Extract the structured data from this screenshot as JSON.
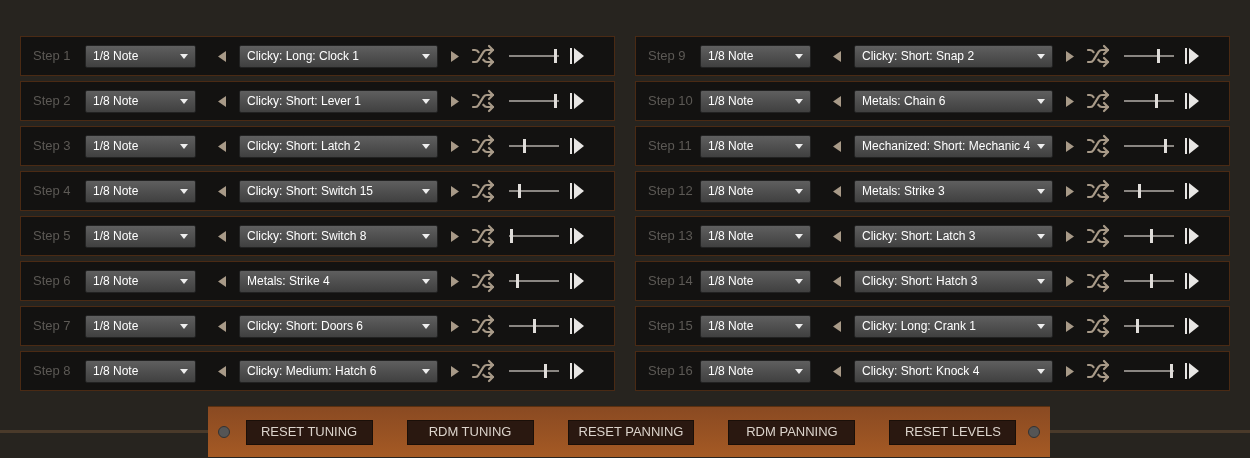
{
  "steps": [
    {
      "label": "Step 1",
      "rate": "1/8 Note",
      "sample": "Clicky: Long: Clock 1",
      "level": 0.95
    },
    {
      "label": "Step 2",
      "rate": "1/8 Note",
      "sample": "Clicky: Short: Lever 1",
      "level": 0.95
    },
    {
      "label": "Step 3",
      "rate": "1/8 Note",
      "sample": "Clicky: Short: Latch 2",
      "level": 0.3
    },
    {
      "label": "Step 4",
      "rate": "1/8 Note",
      "sample": "Clicky: Short: Switch 15",
      "level": 0.2
    },
    {
      "label": "Step 5",
      "rate": "1/8 Note",
      "sample": "Clicky: Short: Switch 8",
      "level": 0.03
    },
    {
      "label": "Step 6",
      "rate": "1/8 Note",
      "sample": "Metals: Strike 4",
      "level": 0.15
    },
    {
      "label": "Step 7",
      "rate": "1/8 Note",
      "sample": "Clicky: Short: Doors 6",
      "level": 0.5
    },
    {
      "label": "Step 8",
      "rate": "1/8 Note",
      "sample": "Clicky: Medium: Hatch 6",
      "level": 0.75
    },
    {
      "label": "Step 9",
      "rate": "1/8 Note",
      "sample": "Clicky: Short: Snap 2",
      "level": 0.7
    },
    {
      "label": "Step 10",
      "rate": "1/8 Note",
      "sample": "Metals: Chain 6",
      "level": 0.65
    },
    {
      "label": "Step 11",
      "rate": "1/8 Note",
      "sample": "Mechanized: Short: Mechanic 4",
      "level": 0.85
    },
    {
      "label": "Step 12",
      "rate": "1/8 Note",
      "sample": "Metals: Strike 3",
      "level": 0.3
    },
    {
      "label": "Step 13",
      "rate": "1/8 Note",
      "sample": "Clicky: Short: Latch 3",
      "level": 0.55
    },
    {
      "label": "Step 14",
      "rate": "1/8 Note",
      "sample": "Clicky: Short: Hatch 3",
      "level": 0.55
    },
    {
      "label": "Step 15",
      "rate": "1/8 Note",
      "sample": "Clicky: Long: Crank 1",
      "level": 0.25
    },
    {
      "label": "Step 16",
      "rate": "1/8 Note",
      "sample": "Clicky: Short: Knock 4",
      "level": 0.97
    }
  ],
  "buttons": [
    "RESET TUNING",
    "RDM TUNING",
    "RESET PANNING",
    "RDM PANNING",
    "RESET LEVELS"
  ]
}
